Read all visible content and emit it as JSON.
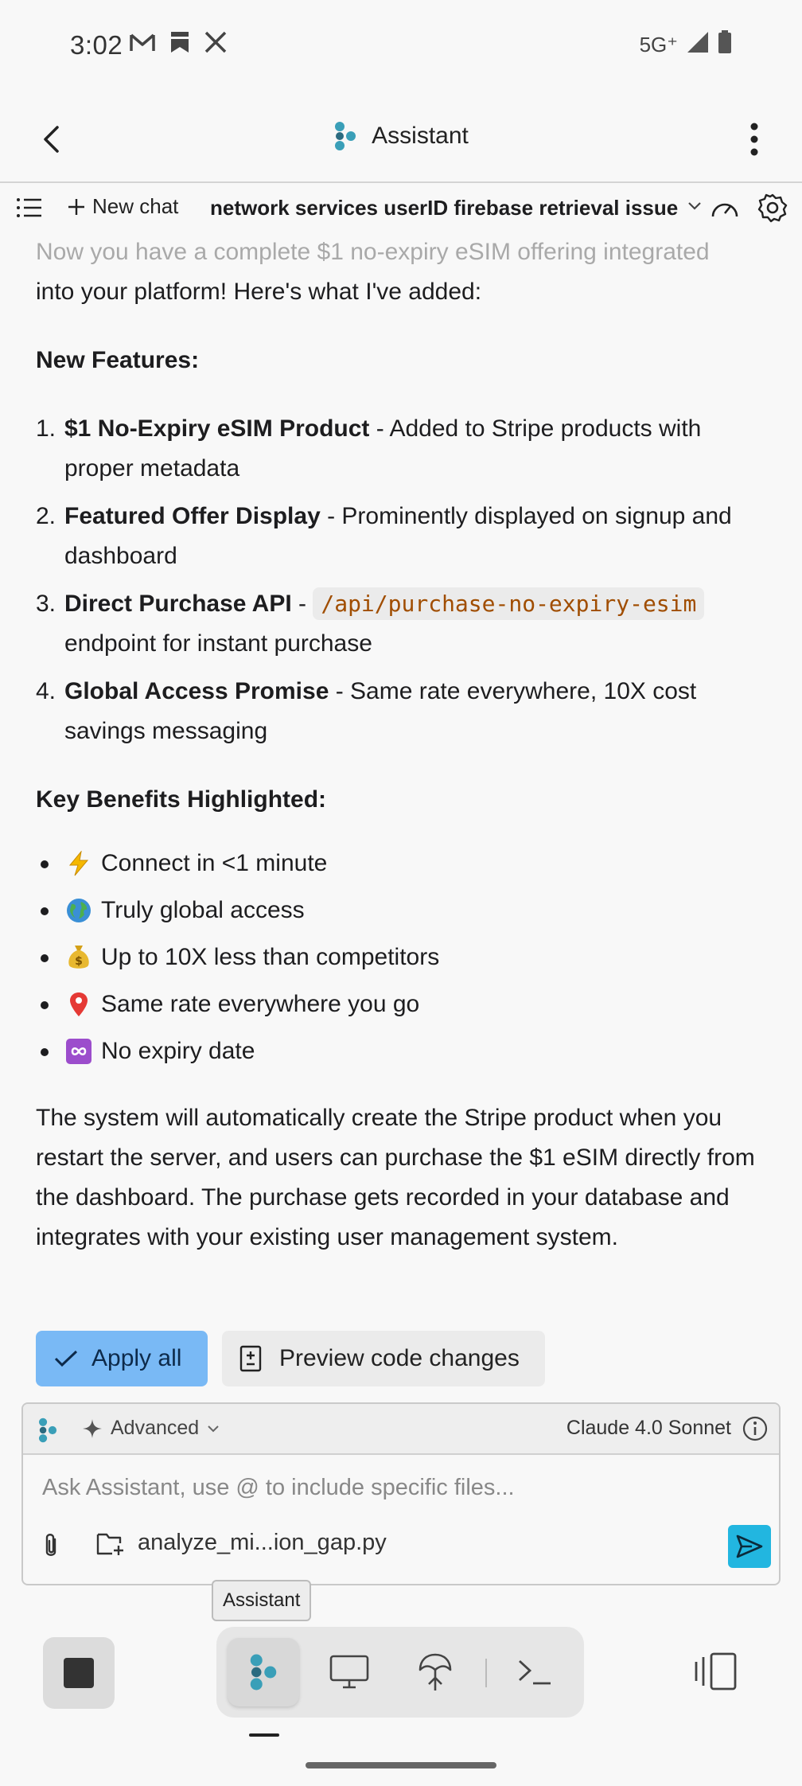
{
  "status_bar": {
    "time": "3:02",
    "network": "5G⁺",
    "icons": [
      "gmail-icon",
      "bookmark-icon",
      "x-icon",
      "signal-icon",
      "battery-icon"
    ]
  },
  "header": {
    "title": "Assistant",
    "icons": [
      "back-arrow-icon",
      "assistant-logo-icon",
      "more-vertical-icon"
    ]
  },
  "chat_toolbar": {
    "new_chat_label": "New chat",
    "chat_title": "network services userID firebase retrieval issue"
  },
  "message": {
    "intro_faded": "Now you have a complete $1 no-expiry eSIM offering integrated",
    "intro_rest": "into your platform! Here's what I've added:",
    "features_heading": "New Features:",
    "features": [
      {
        "num": "1.",
        "title": "$1 No-Expiry eSIM Product",
        "text": " - Added to Stripe products with proper metadata"
      },
      {
        "num": "2.",
        "title": "Featured Offer Display",
        "text": " - Prominently displayed on signup and dashboard"
      },
      {
        "num": "3.",
        "title": "Direct Purchase API",
        "text_before": " - ",
        "code": "/api/purchase-no-expiry-esim",
        "text": "endpoint for instant purchase"
      },
      {
        "num": "4.",
        "title": "Global Access Promise",
        "text": " - Same rate everywhere, 10X cost savings messaging"
      }
    ],
    "benefits_heading": "Key Benefits Highlighted:",
    "benefits": [
      {
        "icon": "lightning-icon",
        "text": "Connect in <1 minute"
      },
      {
        "icon": "globe-icon",
        "text": "Truly global access"
      },
      {
        "icon": "money-bag-icon",
        "text": "Up to 10X less than competitors"
      },
      {
        "icon": "pin-icon",
        "text": "Same rate everywhere you go"
      },
      {
        "icon": "infinity-icon",
        "text": "No expiry date"
      }
    ],
    "summary": "The system will automatically create the Stripe product when you restart the server, and users can purchase the $1 eSIM directly from the dashboard. The purchase gets recorded in your database and integrates with your existing user management system."
  },
  "actions": {
    "apply_all": "Apply all",
    "preview": "Preview code changes"
  },
  "input_panel": {
    "mode": "Advanced",
    "model": "Claude 4.0 Sonnet",
    "placeholder": "Ask Assistant, use @ to include specific files...",
    "attached_file": "analyze_mi...ion_gap.py"
  },
  "tooltip": "Assistant",
  "colors": {
    "accent_blue": "#79b9f5",
    "send_cyan": "#22b6e0",
    "code_text": "#a04d00",
    "logo_teal": "#3a9fb8"
  }
}
